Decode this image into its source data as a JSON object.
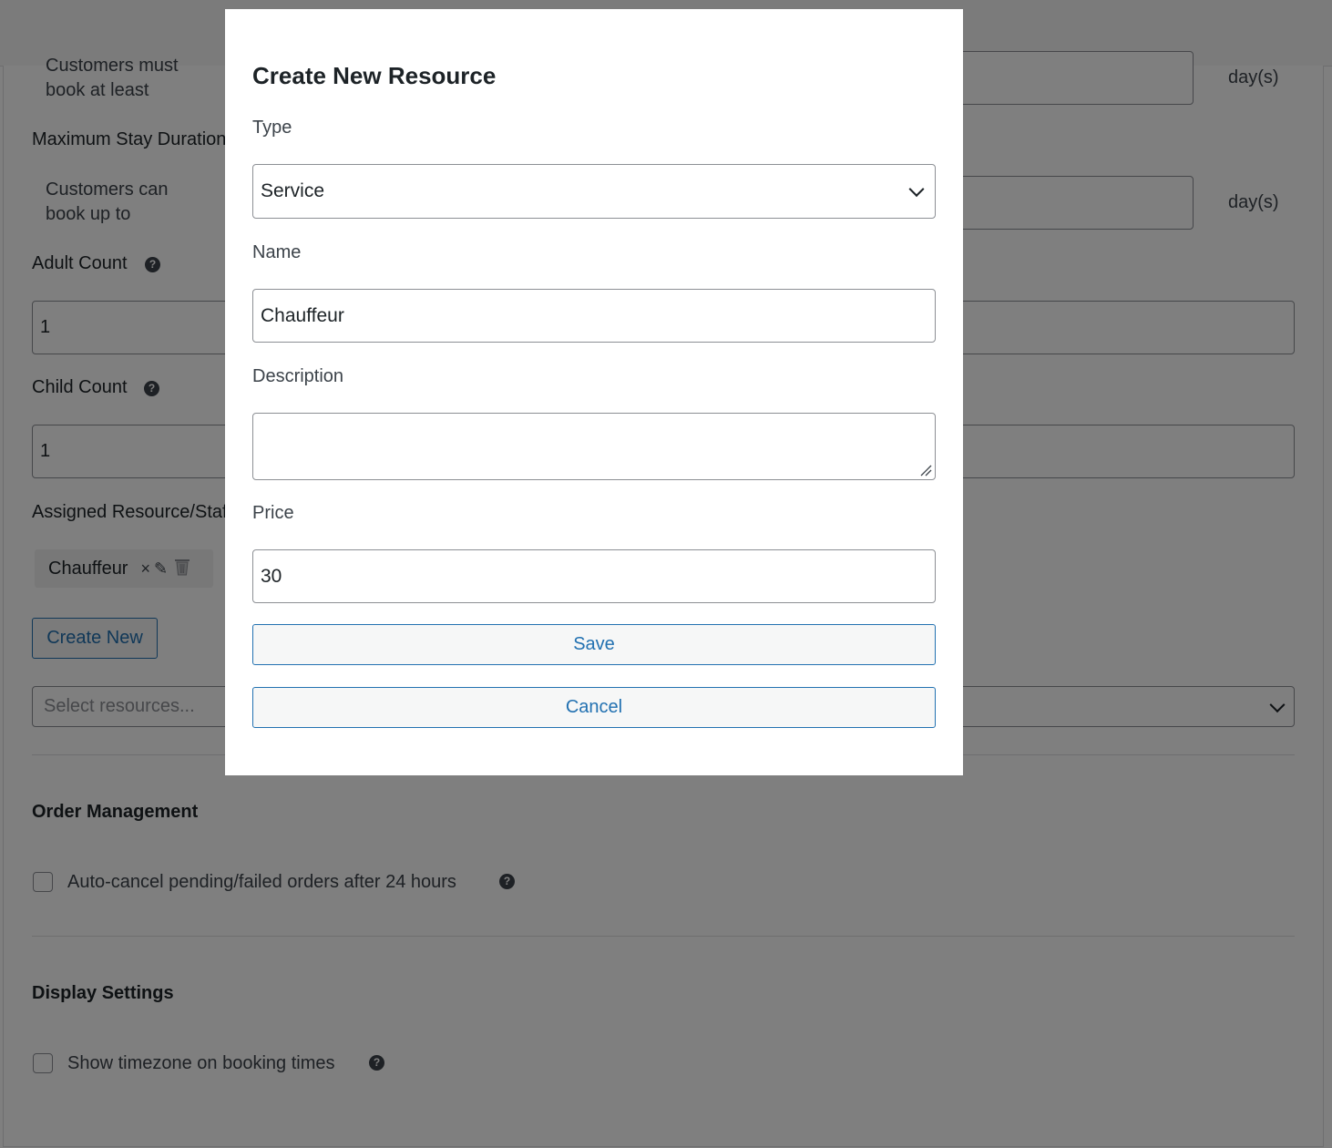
{
  "background": {
    "min_stay": {
      "text_line1": "Customers must",
      "text_line2": "book at least",
      "unit": "day(s)"
    },
    "max_stay": {
      "label": "Maximum Stay Duration",
      "text_line1": "Customers can",
      "text_line2": "book up to",
      "unit": "day(s)"
    },
    "adult_count": {
      "label": "Adult Count",
      "value": "1"
    },
    "child_count": {
      "label": "Child Count",
      "value": "1"
    },
    "assigned_resources": {
      "label": "Assigned Resource/Staff",
      "tag_label": "Chauffeur",
      "tag_remove": "×",
      "tag_edit": "✎",
      "create_new_label": "Create New",
      "select_placeholder": "Select resources..."
    },
    "order_management": {
      "title": "Order Management",
      "auto_cancel_label": "Auto-cancel pending/failed orders after 24 hours"
    },
    "display_settings": {
      "title": "Display Settings",
      "show_timezone_label": "Show timezone on booking times"
    },
    "help_glyph": "?"
  },
  "modal": {
    "title": "Create New Resource",
    "type_label": "Type",
    "type_value": "Service",
    "name_label": "Name",
    "name_value": "Chauffeur",
    "description_label": "Description",
    "description_value": "",
    "price_label": "Price",
    "price_value": "30",
    "save_label": "Save",
    "cancel_label": "Cancel"
  },
  "colors": {
    "accent": "#2271b1",
    "overlay": "rgba(0,0,0,0.5)"
  }
}
